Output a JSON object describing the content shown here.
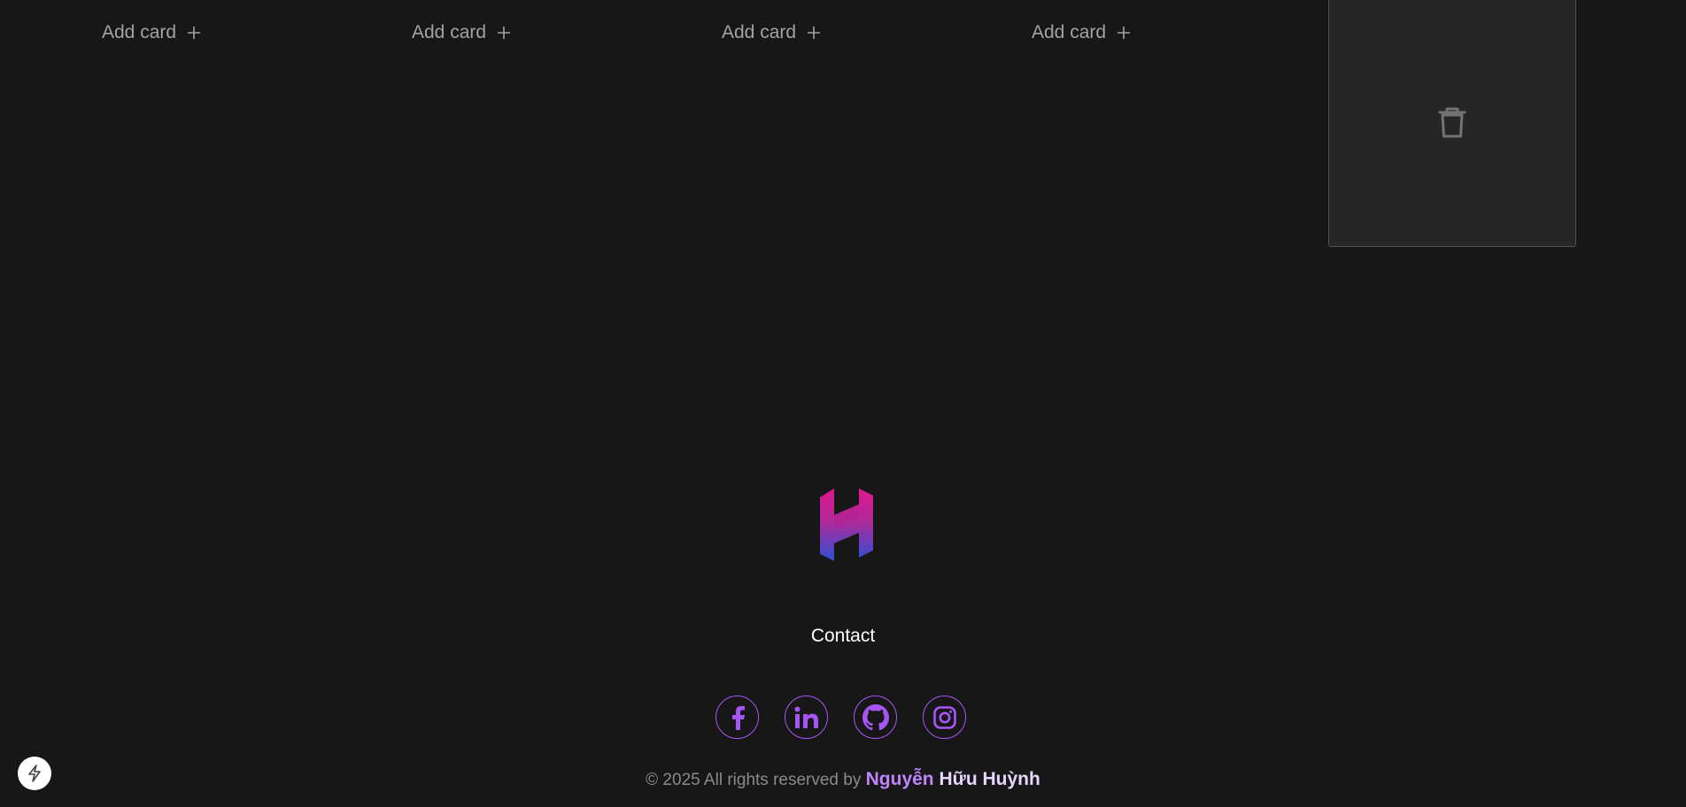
{
  "columns": [
    {
      "add_label": "Add card"
    },
    {
      "add_label": "Add card"
    },
    {
      "add_label": "Add card"
    },
    {
      "add_label": "Add card"
    }
  ],
  "footer": {
    "contact_label": "Contact",
    "copyright_prefix": "© 2025 All rights reserved by ",
    "author_first": "Nguyễn",
    "author_last": " Hữu Huỳnh",
    "socials": [
      {
        "icon": "facebook-icon"
      },
      {
        "icon": "linkedin-icon"
      },
      {
        "icon": "github-icon"
      },
      {
        "icon": "instagram-icon"
      }
    ]
  },
  "colors": {
    "background": "#171717",
    "accent": "#a855f7",
    "trash_bg": "#262626"
  },
  "icons": {
    "add": "plus-icon",
    "trash": "trash-icon",
    "logo": "brand-h-logo",
    "bolt": "bolt-icon"
  }
}
